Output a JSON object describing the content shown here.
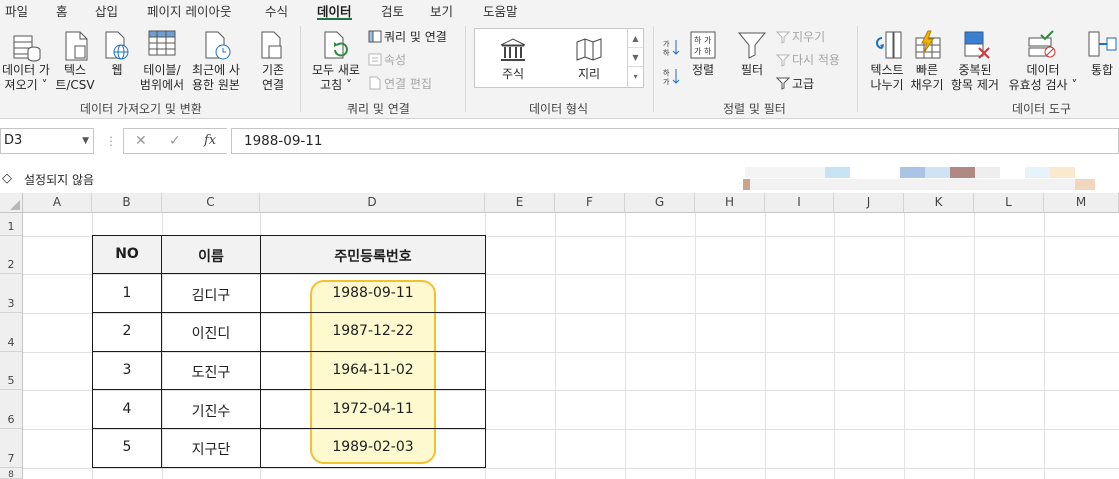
{
  "tabs": [
    "파일",
    "홈",
    "삽입",
    "페이지 레이아웃",
    "수식",
    "데이터",
    "검토",
    "보기",
    "도움말"
  ],
  "active_tab": "데이터",
  "ribbon": {
    "get_data": {
      "line1": "데이터 가",
      "line2": "져오기 ˅"
    },
    "text_csv": {
      "line1": "텍스",
      "line2": "트/CSV"
    },
    "web": {
      "line1": "웹"
    },
    "table_range": {
      "line1": "테이블/",
      "line2": "범위에서"
    },
    "recent_sources": {
      "line1": "최근에 사",
      "line2": "용한 원본"
    },
    "existing_conn": {
      "line1": "기존",
      "line2": "연결"
    },
    "group_get_transform": "데이터 가져오기 및 변환",
    "refresh_all": {
      "line1": "모두 새로",
      "line2": "고침 ˅"
    },
    "queries_connections": "쿼리 및 연결",
    "properties": "속성",
    "edit_links": "연결 편집",
    "group_queries": "쿼리 및 연결",
    "data_types": [
      "주식",
      "지리"
    ],
    "group_data_types": "데이터 형식",
    "sort": "정렬",
    "filter": "필터",
    "clear": "지우기",
    "reapply": "다시 적용",
    "advanced": "고급",
    "group_sort_filter": "정렬 및 필터",
    "text_to_columns": {
      "line1": "텍스트",
      "line2": "나누기"
    },
    "flash_fill": {
      "line1": "빠른",
      "line2": "채우기"
    },
    "remove_duplicates": {
      "line1": "중복된",
      "line2": "항목 제거"
    },
    "data_validation": {
      "line1": "데이터",
      "line2": "유효성 검사 ˅"
    },
    "consolidate": {
      "line1": "통합"
    },
    "group_data_tools": "데이터 도구"
  },
  "name_box": "D3",
  "formula": "1988-09-11",
  "sensitivity_label": "설정되지 않음",
  "columns": [
    "A",
    "B",
    "C",
    "D",
    "E",
    "F",
    "G",
    "H",
    "I",
    "J",
    "K",
    "L",
    "M"
  ],
  "rows": [
    "1",
    "2",
    "3",
    "4",
    "5",
    "6",
    "7",
    "8"
  ],
  "table": {
    "headers": [
      "NO",
      "이름",
      "주민등록번호"
    ],
    "rows": [
      [
        "1",
        "김디구",
        "1988-09-11"
      ],
      [
        "2",
        "이진디",
        "1987-12-22"
      ],
      [
        "3",
        "도진구",
        "1964-11-02"
      ],
      [
        "4",
        "기진수",
        "1972-04-11"
      ],
      [
        "5",
        "지구단",
        "1989-02-03"
      ]
    ]
  },
  "colors": {
    "accent": "#217346",
    "highlight_border": "#f2c12e",
    "highlight_fill": "#fff4aa"
  }
}
